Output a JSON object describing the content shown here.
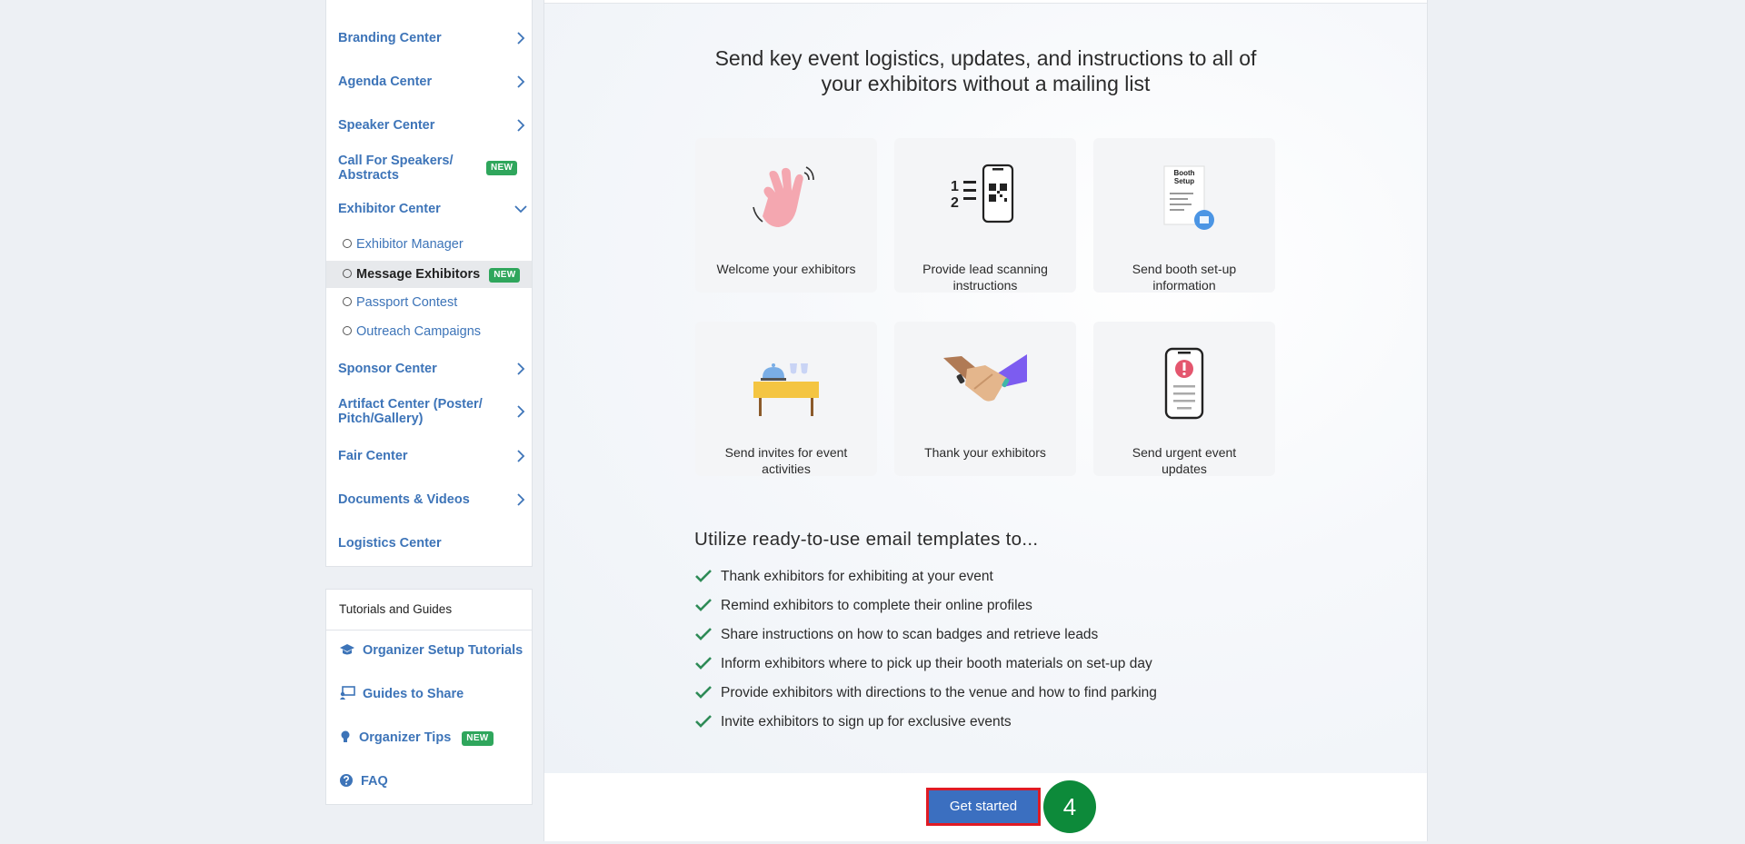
{
  "sidebar": {
    "items": [
      {
        "label": "Branding Center"
      },
      {
        "label": "Agenda Center"
      },
      {
        "label": "Speaker Center"
      },
      {
        "label_line1": "Call For Speakers/",
        "label_line2": "Abstracts",
        "badge": "NEW"
      },
      {
        "label": "Exhibitor Center"
      },
      {
        "label": "Sponsor Center"
      },
      {
        "label_line1": "Artifact Center (Poster/",
        "label_line2": "Pitch/Gallery)"
      },
      {
        "label": "Fair Center"
      },
      {
        "label": "Documents & Videos"
      },
      {
        "label": "Logistics Center"
      }
    ],
    "sub_items": [
      {
        "label": "Exhibitor Manager"
      },
      {
        "label": "Message Exhibitors",
        "badge": "NEW"
      },
      {
        "label": "Passport Contest"
      },
      {
        "label": "Outreach Campaigns"
      }
    ]
  },
  "tutorials": {
    "header": "Tutorials and Guides",
    "items": [
      {
        "label": "Organizer Setup Tutorials",
        "icon": "graduation-cap-icon"
      },
      {
        "label": "Guides to Share",
        "icon": "presentation-icon"
      },
      {
        "label": "Organizer Tips",
        "icon": "lightbulb-icon",
        "badge": "NEW"
      },
      {
        "label": "FAQ",
        "icon": "question-circle-icon"
      }
    ]
  },
  "main": {
    "headline_line1": "Send key event logistics, updates, and instructions to all of",
    "headline_line2": "your exhibitors without a mailing list",
    "cards": [
      {
        "line1": "Welcome your exhibitors",
        "line2": ""
      },
      {
        "line1": "Provide lead scanning",
        "line2": "instructions"
      },
      {
        "line1": "Send booth set-up",
        "line2": "information"
      },
      {
        "line1": "Send invites for event",
        "line2": "activities"
      },
      {
        "line1": "Thank your exhibitors",
        "line2": ""
      },
      {
        "line1": "Send urgent event",
        "line2": "updates"
      }
    ],
    "booth_doc_text_1": "Booth",
    "booth_doc_text_2": "Setup",
    "templates_heading": "Utilize ready-to-use email templates to...",
    "templates": [
      "Thank exhibitors for exhibiting at your event",
      "Remind exhibitors to complete their online profiles",
      "Share instructions on how to scan badges and retrieve leads",
      "Inform exhibitors where to pick up their booth materials on set-up day",
      "Provide exhibitors with directions to the venue and how to find parking",
      "Invite exhibitors to sign up for exclusive events"
    ],
    "cta_label": "Get started",
    "step_number": "4"
  },
  "colors": {
    "link": "#3d74b8",
    "badge": "#2fa65c",
    "cta": "#3b6fc0",
    "cta_outline": "#e01b24",
    "step": "#0d8a3a",
    "check": "#2e8b57"
  }
}
